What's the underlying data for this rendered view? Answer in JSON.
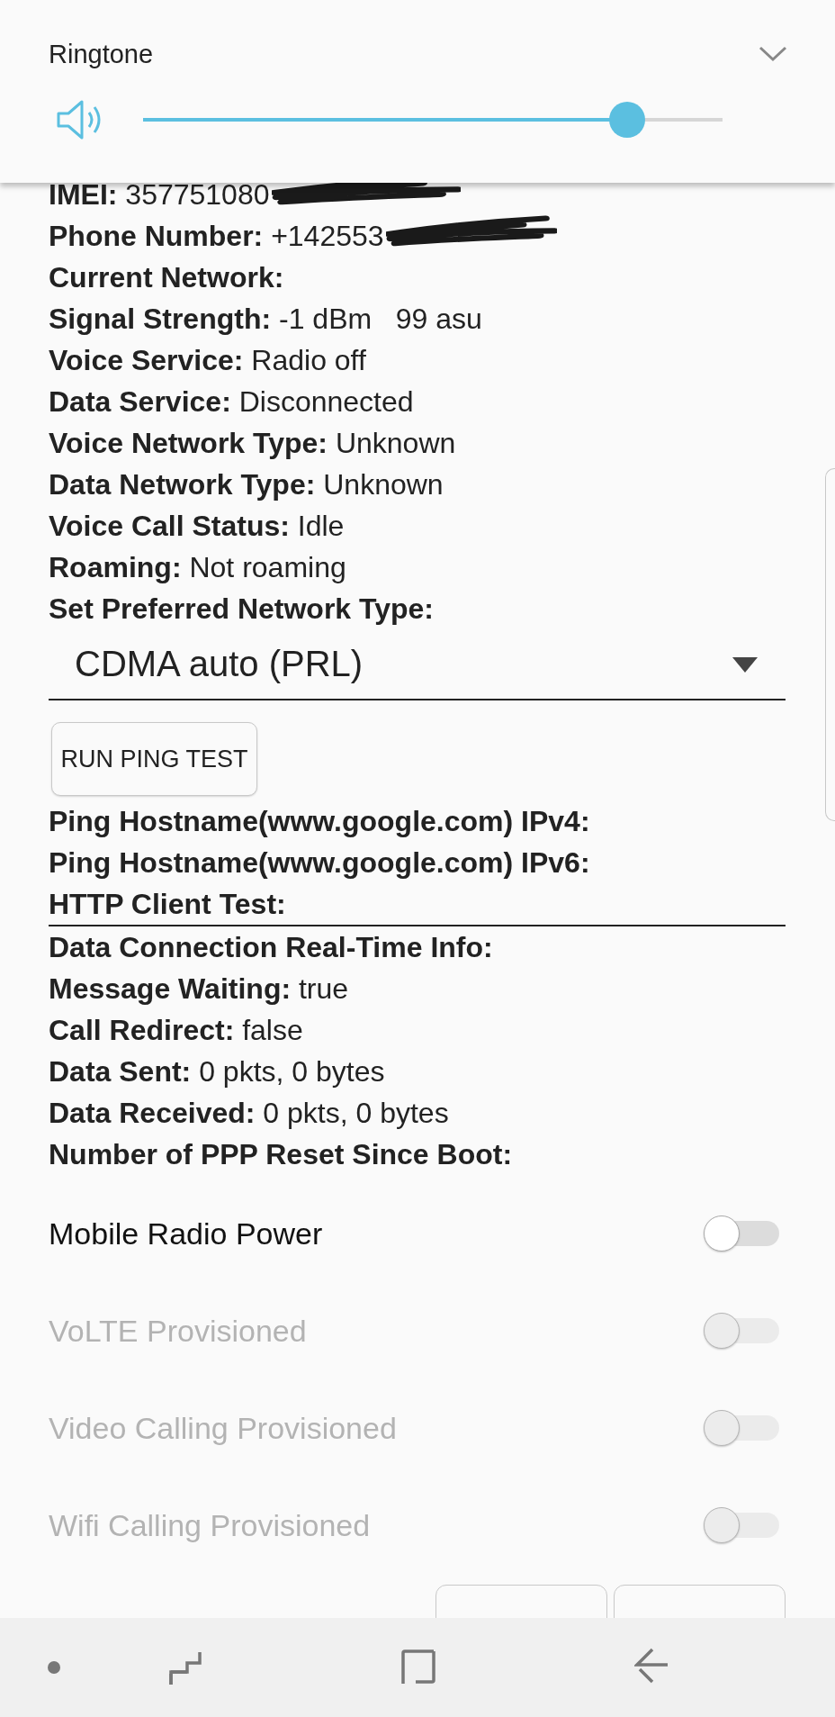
{
  "volume_panel": {
    "title": "Ringtone",
    "level": 0.835
  },
  "info_rows": [
    {
      "label": "IMEI:",
      "value": "357751080",
      "redacted": true
    },
    {
      "label": "Phone Number:",
      "value": "+142553",
      "redacted": true
    },
    {
      "label": "Current Network:",
      "redacted": false
    },
    {
      "label": "Signal Strength:",
      "value": "-1 dBm   99 asu",
      "redacted": false
    },
    {
      "label": "Voice Service:",
      "value": "Radio off",
      "redacted": false
    },
    {
      "label": "Data Service:",
      "value": "Disconnected",
      "redacted": false
    },
    {
      "label": "Voice Network Type:",
      "value": "Unknown",
      "redacted": false
    },
    {
      "label": "Data Network Type:",
      "value": "Unknown",
      "redacted": false
    },
    {
      "label": "Voice Call Status:",
      "value": "Idle",
      "redacted": false
    },
    {
      "label": "Roaming:",
      "value": "Not roaming",
      "redacted": false
    },
    {
      "label": "Set Preferred Network Type:",
      "redacted": false
    }
  ],
  "network_dropdown": {
    "value": "CDMA auto (PRL)"
  },
  "ping_button": "RUN PING TEST",
  "test_rows": [
    {
      "label": "Ping Hostname(www.google.com) IPv4:"
    },
    {
      "label": "Ping Hostname(www.google.com) IPv6:"
    },
    {
      "label": "HTTP Client Test:"
    }
  ],
  "realtime_rows": [
    {
      "label": "Data Connection Real-Time Info:"
    },
    {
      "label": "Message Waiting:",
      "value": "true"
    },
    {
      "label": "Call Redirect:",
      "value": "false"
    },
    {
      "label": "Data Sent:",
      "value": "0 pkts, 0 bytes"
    },
    {
      "label": "Data Received:",
      "value": "0 pkts, 0 bytes"
    },
    {
      "label": "Number of PPP Reset Since Boot:"
    }
  ],
  "toggles": [
    {
      "label": "Mobile Radio Power",
      "on": false,
      "disabled": false
    },
    {
      "label": "VoLTE Provisioned",
      "on": false,
      "disabled": true
    },
    {
      "label": "Video Calling Provisioned",
      "on": false,
      "disabled": true
    },
    {
      "label": "Wifi Calling Provisioned",
      "on": false,
      "disabled": true
    }
  ]
}
